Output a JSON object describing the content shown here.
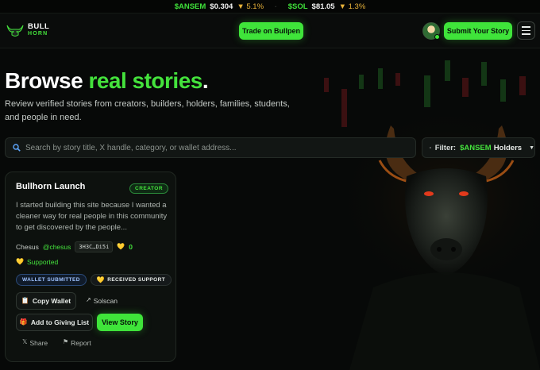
{
  "ticker": [
    {
      "symbol": "$ANSEM",
      "price": "$0.304",
      "change": "▼ 5.1%"
    },
    {
      "symbol": "$SOL",
      "price": "$81.05",
      "change": "▼ 1.3%"
    }
  ],
  "ticker_separator": "·",
  "logo": {
    "line1": "BULL",
    "line2": "HORN"
  },
  "header": {
    "trade_label": "Trade on Bullpen",
    "submit_label": "Submit Your Story"
  },
  "hero": {
    "title_main": "Browse ",
    "title_accent": "real stories",
    "title_end": ".",
    "subtitle": "Review verified stories from creators, builders, holders, families, students, and people in need."
  },
  "search": {
    "placeholder": "Search by story title, X handle, category, or wallet address...",
    "value": ""
  },
  "filter": {
    "label": "Filter:",
    "value_accent": "$ANSEM",
    "value_rest": "Holders"
  },
  "card": {
    "title": "Bullhorn Launch",
    "category": "CREATOR",
    "description": "I started building this site because I wanted a cleaner way for real people in this community to get discovered by the people...",
    "author": "Chesus",
    "handle": "@chesus",
    "wallet": "3H3C…Di5i",
    "support_count": "0",
    "supported_label": "Supported",
    "status_wallet": "WALLET SUBMITTED",
    "status_support": "RECEIVED SUPPORT",
    "copy_wallet": "Copy Wallet",
    "solscan": "Solscan",
    "add_giving": "Add to Giving List",
    "view_story": "View Story",
    "share": "Share",
    "report": "Report"
  },
  "colors": {
    "accent": "#44e23c",
    "background": "#070908",
    "ticker_down": "#e8b23a",
    "card_bg": "#0d110e"
  },
  "icons": {
    "search": "magnifier-icon",
    "filter": "filter-lines-icon",
    "heart": "yellow-heart-icon",
    "clipboard": "clipboard-icon",
    "external": "arrow-up-right-icon",
    "gift": "gift-icon",
    "x": "x-logo-icon",
    "flag": "flag-icon",
    "menu": "hamburger-icon"
  }
}
